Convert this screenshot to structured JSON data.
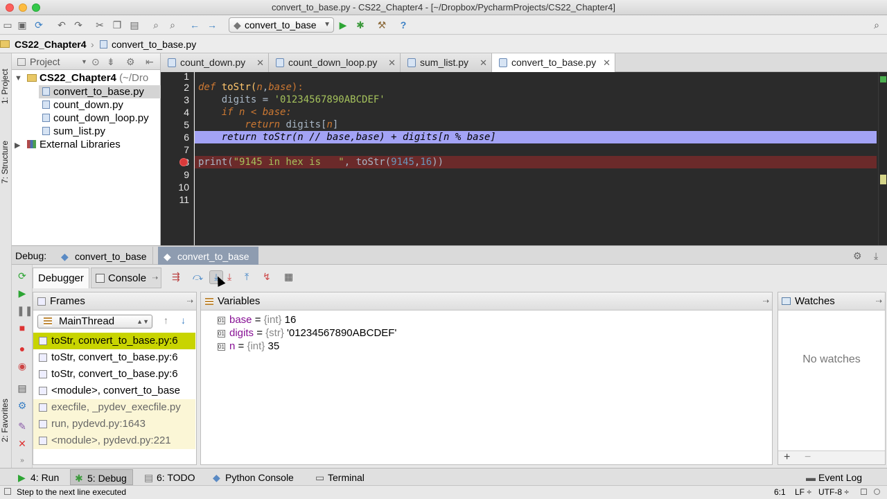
{
  "window": {
    "title": "convert_to_base.py - CS22_Chapter4 - [~/Dropbox/PycharmProjects/CS22_Chapter4]"
  },
  "toolbar": {
    "run_config": "convert_to_base"
  },
  "navbar": {
    "project": "CS22_Chapter4",
    "file": "convert_to_base.py"
  },
  "left_stripe": {
    "project_tab": "1: Project",
    "structure_tab": "7: Structure",
    "favorites_tab": "2: Favorites"
  },
  "project_panel": {
    "title": "Project",
    "root": "CS22_Chapter4",
    "root_path": "(~/Dro",
    "files": [
      "convert_to_base.py",
      "count_down.py",
      "count_down_loop.py",
      "sum_list.py"
    ],
    "external": "External Libraries"
  },
  "editor_tabs": [
    "count_down.py",
    "count_down_loop.py",
    "sum_list.py",
    "convert_to_base.py"
  ],
  "editor": {
    "line_numbers": [
      "1",
      "2",
      "3",
      "4",
      "5",
      "6",
      "7",
      "8",
      "9",
      "10",
      "11"
    ],
    "line2": {
      "kw": "def",
      "name": " toStr(",
      "p1": "n",
      "sep": ",",
      "p2": "base",
      "end": "):"
    },
    "line3": {
      "a": "    digits = ",
      "s": "'01234567890ABCDEF'"
    },
    "line4": {
      "kw": "    if",
      "cond": " n < base:"
    },
    "line5": {
      "kw": "        return",
      "rest": " digits[",
      "n": "n",
      "end": "]"
    },
    "line6": "    return toStr(n // base,base) + digits[n % base]",
    "line8": {
      "a": "print(",
      "s": "\"9145 in hex is   \"",
      "b": ", toStr(",
      "n1": "9145",
      "c": ",",
      "n2": "16",
      "d": "))"
    }
  },
  "debug": {
    "label": "Debug:",
    "tabs": [
      "convert_to_base",
      "convert_to_base"
    ],
    "subtabs": {
      "debugger": "Debugger",
      "console": "Console"
    },
    "frames_title": "Frames",
    "thread": "MainThread",
    "frames": [
      "toStr, convert_to_base.py:6",
      "toStr, convert_to_base.py:6",
      "toStr, convert_to_base.py:6",
      "<module>, convert_to_base",
      "execfile, _pydev_execfile.py",
      "run, pydevd.py:1643",
      "<module>, pydevd.py:221"
    ],
    "variables_title": "Variables",
    "variables": [
      {
        "name": "base",
        "eq": " = ",
        "type": "{int}",
        "value": " 16"
      },
      {
        "name": "digits",
        "eq": " = ",
        "type": "{str}",
        "value": " '01234567890ABCDEF'"
      },
      {
        "name": "n",
        "eq": " = ",
        "type": "{int}",
        "value": " 35"
      }
    ],
    "watches_title": "Watches",
    "no_watches": "No watches"
  },
  "bottom_tools": {
    "run": "4: Run",
    "debug": "5: Debug",
    "todo": "6: TODO",
    "python_console": "Python Console",
    "terminal": "Terminal",
    "event_log": "Event Log"
  },
  "status": {
    "message": "Step to the next line executed",
    "position": "6:1",
    "line_sep": "LF ÷",
    "encoding": "UTF-8 ÷"
  },
  "colors": {
    "editor_bg": "#2b2b2b",
    "exec_line": "#a3a3f5",
    "breakpoint_line": "#6b2a2a",
    "frame_selected": "#c8d400"
  }
}
